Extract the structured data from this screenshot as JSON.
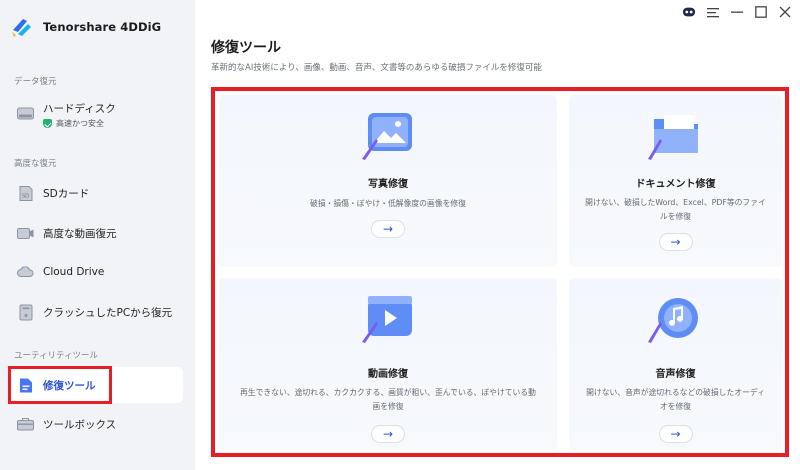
{
  "app": {
    "name": "Tenorshare 4DDiG"
  },
  "sidebar": {
    "section_data_recovery": "データ復元",
    "harddisk": {
      "label": "ハードディスク",
      "sub": "高速かつ安全"
    },
    "section_advanced": "高度な復元",
    "sdcard": {
      "label": "SDカード"
    },
    "video": {
      "label": "高度な動画復元"
    },
    "cloud": {
      "label": "Cloud Drive"
    },
    "crashed_pc": {
      "label": "クラッシュしたPCから復元"
    },
    "section_utility": "ユーティリティツール",
    "repair": {
      "label": "修復ツール"
    },
    "toolbox": {
      "label": "ツールボックス"
    }
  },
  "main": {
    "title": "修復ツール",
    "subtitle": "革新的なAI技術により、画像、動画、音声、文書等のあらゆる破損ファイルを修復可能",
    "cards": {
      "photo": {
        "title": "写真修復",
        "desc": "破損・損傷・ぼやけ・低解像度の画像を修復",
        "button": "→"
      },
      "document": {
        "title": "ドキュメント修復",
        "desc": "開けない、破損したWord、Excel、PDF等のファイルを修復",
        "button": "→"
      },
      "video": {
        "title": "動画修復",
        "desc": "再生できない、途切れる、カクカクする、画質が粗い、歪んでいる、ぼやけている動画を修復",
        "button": "→"
      },
      "audio": {
        "title": "音声修復",
        "desc": "開けない、音声が途切れるなどの破損したオーディオを修復",
        "button": "→"
      }
    }
  },
  "colors": {
    "accent": "#2f55d4",
    "highlight": "#e61e25",
    "sidebar_bg": "#f1f3f7",
    "shield": "#23b26d"
  }
}
